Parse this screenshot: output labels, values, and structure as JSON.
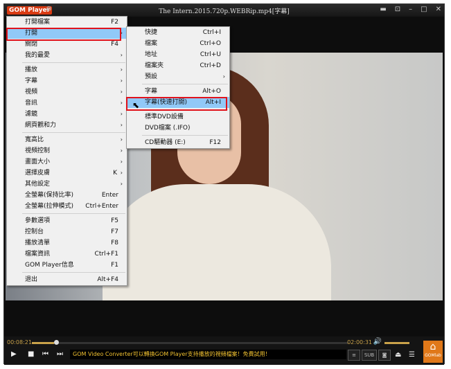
{
  "window": {
    "logo": "GOM Player",
    "title": "The Intern.2015.720p.WEBRip.mp4[字幕]",
    "buttons": [
      "▬",
      "⊡",
      "–",
      "□",
      "✕"
    ]
  },
  "main_menu": {
    "items": [
      {
        "label": "打開檔案",
        "shortcut": "F2",
        "arrow": ""
      },
      {
        "label": "打開",
        "shortcut": "",
        "arrow": "›",
        "highlighted": true
      },
      {
        "label": "關閉",
        "shortcut": "F4",
        "arrow": ""
      },
      {
        "label": "我的最愛",
        "shortcut": "",
        "arrow": "›"
      },
      {
        "separator": true
      },
      {
        "label": "播放",
        "shortcut": "",
        "arrow": "›"
      },
      {
        "label": "字幕",
        "shortcut": "",
        "arrow": "›"
      },
      {
        "label": "視頻",
        "shortcut": "",
        "arrow": "›"
      },
      {
        "label": "音訊",
        "shortcut": "",
        "arrow": "›"
      },
      {
        "label": "濾鏡",
        "shortcut": "",
        "arrow": "›"
      },
      {
        "label": "網頁觀和力",
        "shortcut": "",
        "arrow": "›"
      },
      {
        "separator": true
      },
      {
        "label": "寬高比",
        "shortcut": "",
        "arrow": "›"
      },
      {
        "label": "視頻控制",
        "shortcut": "",
        "arrow": "›"
      },
      {
        "label": "畫面大小",
        "shortcut": "",
        "arrow": "›"
      },
      {
        "label": "選擇皮膚",
        "shortcut": "K",
        "arrow": "›"
      },
      {
        "label": "其他設定",
        "shortcut": "",
        "arrow": "›"
      },
      {
        "label": "全螢幕(保持比率)",
        "shortcut": "Enter",
        "arrow": ""
      },
      {
        "label": "全螢幕(拉伸模式)",
        "shortcut": "Ctrl+Enter",
        "arrow": ""
      },
      {
        "separator": true
      },
      {
        "label": "參數選項",
        "shortcut": "F5",
        "arrow": ""
      },
      {
        "label": "控制台",
        "shortcut": "F7",
        "arrow": ""
      },
      {
        "label": "播放清單",
        "shortcut": "F8",
        "arrow": ""
      },
      {
        "label": "檔案資訊",
        "shortcut": "Ctrl+F1",
        "arrow": ""
      },
      {
        "label": "GOM Player信息",
        "shortcut": "F1",
        "arrow": ""
      },
      {
        "separator": true
      },
      {
        "label": "退出",
        "shortcut": "Alt+F4",
        "arrow": ""
      }
    ]
  },
  "sub_menu": {
    "items": [
      {
        "label": "快捷",
        "shortcut": "Ctrl+I",
        "arrow": ""
      },
      {
        "label": "檔案",
        "shortcut": "Ctrl+O",
        "arrow": ""
      },
      {
        "label": "地址",
        "shortcut": "Ctrl+U",
        "arrow": ""
      },
      {
        "label": "檔案夾",
        "shortcut": "Ctrl+D",
        "arrow": ""
      },
      {
        "label": "預設",
        "shortcut": "",
        "arrow": "›"
      },
      {
        "separator": true
      },
      {
        "label": "字幕",
        "shortcut": "Alt+O",
        "arrow": ""
      },
      {
        "label": "字幕(快速打開)",
        "shortcut": "Alt+I",
        "arrow": "",
        "highlighted": true
      },
      {
        "separator": true
      },
      {
        "label": "標準DVD設備",
        "shortcut": "",
        "arrow": ""
      },
      {
        "label": "DVD檔案 (.IFO)",
        "shortcut": "",
        "arrow": ""
      },
      {
        "separator": true
      },
      {
        "label": "CD驅動器 (E:)",
        "shortcut": "F12",
        "arrow": ""
      }
    ]
  },
  "player": {
    "time_current": "00:08:21",
    "time_total": "02:00:31",
    "progress_percent": 7,
    "marquee": "GOM Video Converter可以轉換GOM Player支持播放的視頻檔案！免費試用！",
    "sub_button": "SUB",
    "gomlab_label": "GOMlab",
    "controls": [
      "▶",
      "■",
      "⏮",
      "⏭"
    ]
  },
  "colors": {
    "highlight": "#91c9f7",
    "redbox": "#e0121b",
    "accent": "#c9a24a",
    "marquee": "#f2c230"
  }
}
